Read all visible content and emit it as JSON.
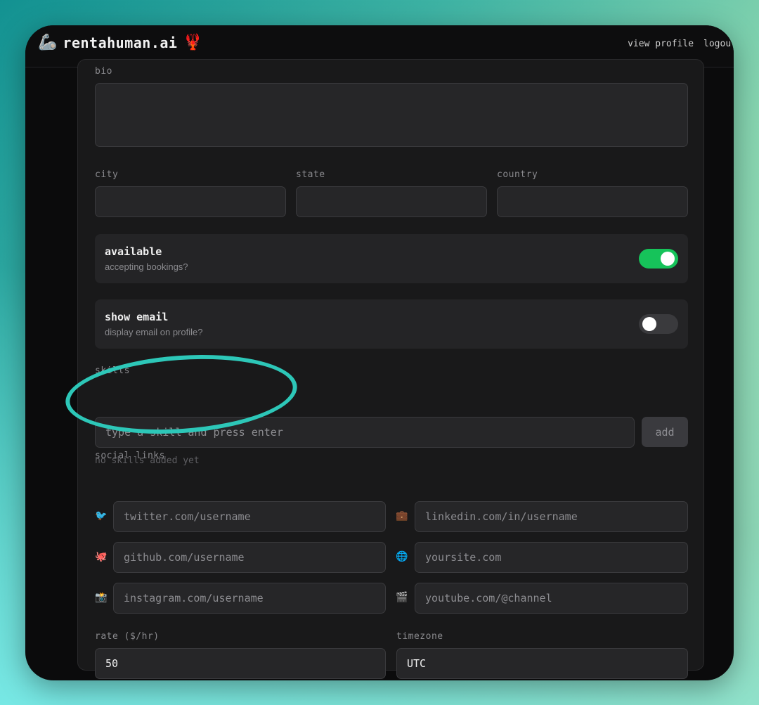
{
  "header": {
    "logo_emoji": "🦾",
    "brand": "rentahuman.ai",
    "brand_emoji": "🦞",
    "nav": {
      "view_profile": "view profile",
      "logout": "logout"
    }
  },
  "form": {
    "bio": {
      "label": "bio",
      "value": ""
    },
    "city": {
      "label": "city",
      "value": ""
    },
    "state": {
      "label": "state",
      "value": ""
    },
    "country": {
      "label": "country",
      "value": ""
    },
    "available": {
      "title": "available",
      "subtitle": "accepting bookings?",
      "on": true
    },
    "show_email": {
      "title": "show email",
      "subtitle": "display email on profile?",
      "on": false
    },
    "skills": {
      "label": "skills",
      "placeholder": "type a skill and press enter",
      "add_label": "add",
      "empty_text": "no skills added yet"
    },
    "social": {
      "label": "social links",
      "twitter": {
        "icon": "🐦",
        "placeholder": "twitter.com/username"
      },
      "linkedin": {
        "icon": "💼",
        "placeholder": "linkedin.com/in/username"
      },
      "github": {
        "icon": "🐙",
        "placeholder": "github.com/username"
      },
      "website": {
        "icon": "🌐",
        "placeholder": "yoursite.com"
      },
      "instagram": {
        "icon": "📸",
        "placeholder": "instagram.com/username"
      },
      "youtube": {
        "icon": "🎬",
        "placeholder": "youtube.com/@channel"
      }
    },
    "rate": {
      "label": "rate ($/hr)",
      "value": "50"
    },
    "timezone": {
      "label": "timezone",
      "value": "UTC"
    }
  },
  "colors": {
    "toggle_on": "#16c35a",
    "highlight": "#2dc7b8"
  }
}
